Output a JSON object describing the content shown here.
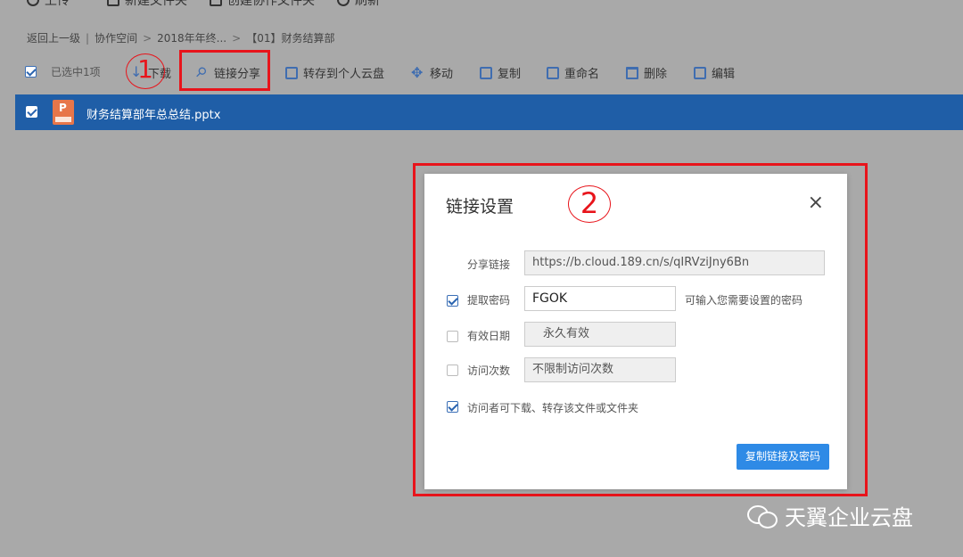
{
  "top_toolbar": {
    "items": [
      "上传",
      "新建文件夹",
      "创建协作文件夹",
      "刷新"
    ]
  },
  "breadcrumb": {
    "back": "返回上一级",
    "sep1": "|",
    "level1": "协作空间",
    "arrow1": ">",
    "level2": "2018年年终...",
    "arrow2": ">",
    "level3": "【01】财务结算部"
  },
  "action_bar": {
    "selected": "已选中1项",
    "download": "下载",
    "share_link": "链接分享",
    "save_to_personal": "转存到个人云盘",
    "move": "移动",
    "copy": "复制",
    "rename": "重命名",
    "delete": "删除",
    "edit": "编辑"
  },
  "file_row": {
    "name": "财务结算部年总总结.pptx"
  },
  "annotations": {
    "step1": "1",
    "step2": "2"
  },
  "dialog": {
    "title": "链接设置",
    "close": "×",
    "share_link_label": "分享链接",
    "share_link_value": "https://b.cloud.189.cn/s/qIRVziJny6Bn",
    "password_label": "提取密码",
    "password_value": "FGOK",
    "password_hint": "可输入您需要设置的密码",
    "validity_label": "有效日期",
    "validity_value": "永久有效",
    "visits_label": "访问次数",
    "visits_value": "不限制访问次数",
    "visitor_permission": "访问者可下载、转存该文件或文件夹",
    "copy_button": "复制链接及密码"
  },
  "watermark": {
    "text": "天翼企业云盘"
  },
  "colors": {
    "accent": "#2e8ae6",
    "row_selected": "#1f5ea7",
    "annotation_red": "#e8141b",
    "backdrop": "#a9a9a9"
  }
}
